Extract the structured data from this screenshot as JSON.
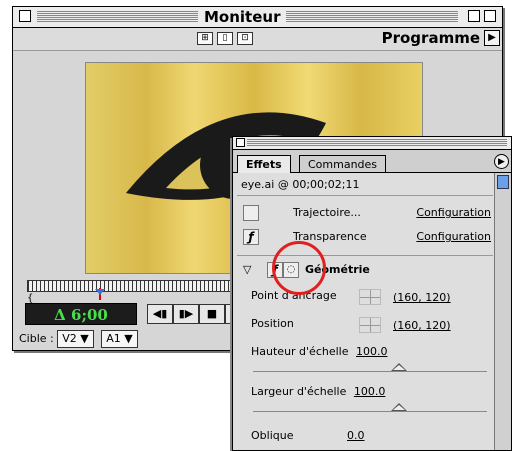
{
  "monitor": {
    "title": "Moniteur",
    "program_label": "Programme",
    "timecode": "Δ 6;00",
    "cible_label": "Cible :",
    "video_target": "V2",
    "audio_target": "A1"
  },
  "effects": {
    "tabs": [
      {
        "label": "Effets"
      },
      {
        "label": "Commandes"
      }
    ],
    "clip_info": "eye.ai @ 00;00;02;11",
    "rows": [
      {
        "name": "Trajectoire...",
        "link": "Configuration"
      },
      {
        "name": "Transparence",
        "link": "Configuration"
      }
    ],
    "geometry": {
      "title": "Géométrie",
      "anchor_label": "Point d'ancrage",
      "anchor_value": "(160, 120)",
      "position_label": "Position",
      "position_value": "(160, 120)",
      "height_scale_label": "Hauteur d'échelle",
      "height_scale_value": "100.0",
      "width_scale_label": "Largeur d'échelle",
      "width_scale_value": "100.0",
      "skew_label": "Oblique",
      "skew_value": "0.0"
    }
  },
  "colors": {
    "timecode_text": "#45e04a",
    "highlight_circle": "#e02020",
    "preview_yellow": "#e2cd68"
  }
}
